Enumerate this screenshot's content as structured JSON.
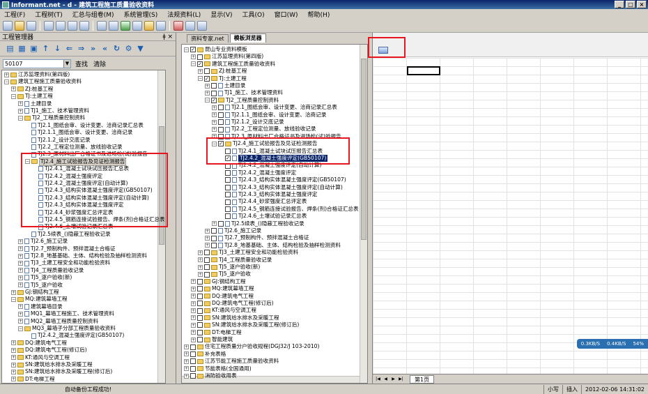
{
  "window": {
    "title": "Informant.net - d - 建筑工程施工质量验收资料"
  },
  "menu": [
    "工程(F)",
    "工程树(T)",
    "汇总与组卷(M)",
    "系统管理(S)",
    "法规资料(L)",
    "显示(V)",
    "工具(O)",
    "窗口(W)",
    "帮助(H)"
  ],
  "left": {
    "header": "工程管理器",
    "search": {
      "value": "50107",
      "find_label": "查找",
      "clear_label": "清除"
    },
    "tree": [
      {
        "d": 0,
        "t": "江苏监理资料(第四版)"
      },
      {
        "d": 0,
        "t": "建筑工程施工质量验收资料"
      },
      {
        "d": 1,
        "t": "ZJ:桩基工程"
      },
      {
        "d": 1,
        "t": "TJ:土建工程"
      },
      {
        "d": 2,
        "t": "土建目录"
      },
      {
        "d": 2,
        "t": "TJ1_施工、技术管理资料"
      },
      {
        "d": 2,
        "t": "TJ2_工程质量控制资料"
      },
      {
        "d": 3,
        "t": "TJ2.1_图纸会审、设计变更、洽商记录汇总表"
      },
      {
        "d": 3,
        "t": "TJ2.1.1_图纸会审、设计变更、洽商记录"
      },
      {
        "d": 3,
        "t": "TJ2.1.2_设计交底记录"
      },
      {
        "d": 3,
        "t": "TJ2.2_工程定位测量、放线验收记录"
      },
      {
        "d": 3,
        "t": "TJ2.3_原材料出厂合格证书及进场检(试)验报告"
      },
      {
        "d": 3,
        "t": "TJ2.4_施工试验报告及见证检测报告"
      },
      {
        "d": 4,
        "t": "TJ2.4.1_混凝土试块试压报告汇总表"
      },
      {
        "d": 4,
        "t": "TJ2.4.2_混凝土强度评定"
      },
      {
        "d": 4,
        "t": "TJ2.4.2_混凝土强度评定(自动计算)"
      },
      {
        "d": 4,
        "t": "TJ2.4.3_结构实体混凝土强度评定(GB50107)"
      },
      {
        "d": 4,
        "t": "TJ2.4.3_结构实体混凝土强度评定(自动计算)"
      },
      {
        "d": 4,
        "t": "TJ2.4.3_结构实体混凝土强度评定"
      },
      {
        "d": 4,
        "t": "TJ2.4.4_砂浆强度汇总评定表"
      },
      {
        "d": 4,
        "t": "TJ2.4.5_钢筋连接试验报告、焊条(剂)合格证汇总表"
      },
      {
        "d": 4,
        "t": "TJ2.4.6_土壤试验记录汇总表"
      },
      {
        "d": 3,
        "t": "TJ2.5续表_()隐蔽工程验收记录"
      },
      {
        "d": 2,
        "t": "TJ2.6_施工记录"
      },
      {
        "d": 2,
        "t": "TJ2.7_预制构件、预拌混凝土合格证"
      },
      {
        "d": 2,
        "t": "TJ2.8_地基基础、主体、结构检验及抽样检测资料"
      },
      {
        "d": 2,
        "t": "TJ3_土建工程安全和功能检验资料"
      },
      {
        "d": 2,
        "t": "TJ4_工程质量验收记录"
      },
      {
        "d": 2,
        "t": "TJ5_逐户验收(新)"
      },
      {
        "d": 2,
        "t": "TJ5_逐户验收"
      },
      {
        "d": 1,
        "t": "GJ:钢结构工程"
      },
      {
        "d": 1,
        "t": "MQ:建筑幕墙工程"
      },
      {
        "d": 2,
        "t": "建筑幕墙目录"
      },
      {
        "d": 2,
        "t": "MQ1_幕墙工程施工、技术管理资料"
      },
      {
        "d": 2,
        "t": "MQ2_幕墙工程质量控制资料"
      },
      {
        "d": 2,
        "t": "MQ3_幕墙子分部工程质量验收资料"
      },
      {
        "d": 3,
        "t": "TJ2.4.2_混凝土强度评定(GB50107)"
      },
      {
        "d": 1,
        "t": "DQ:建筑电气工程"
      },
      {
        "d": 1,
        "t": "DQ:建筑电气工程(修订后)"
      },
      {
        "d": 1,
        "t": "KT:通风与空调工程"
      },
      {
        "d": 1,
        "t": "SN:建筑给水排水及采暖工程"
      },
      {
        "d": 1,
        "t": "SN:建筑给水排水及采暖工程(修订后)"
      },
      {
        "d": 1,
        "t": "DT:电梯工程"
      }
    ]
  },
  "middle": {
    "tabs": [
      "资料专家.net",
      "模板浏览器"
    ],
    "tree": [
      {
        "d": 0,
        "t": "昆山专业资料模板"
      },
      {
        "d": 1,
        "t": "江苏监理资料(第四版)"
      },
      {
        "d": 1,
        "t": "建筑工程施工质量验收资料"
      },
      {
        "d": 2,
        "t": "ZJ:桩基工程"
      },
      {
        "d": 2,
        "t": "TJ:土建工程"
      },
      {
        "d": 3,
        "t": "土建目录"
      },
      {
        "d": 3,
        "t": "TJ1_施工、技术管理资料"
      },
      {
        "d": 3,
        "t": "TJ2_工程质量控制资料"
      },
      {
        "d": 4,
        "t": "TJ2.1_图纸会审、设计变更、洽商记录汇总表"
      },
      {
        "d": 4,
        "t": "TJ2.1.1_图纸会审、设计变更、洽商记录"
      },
      {
        "d": 4,
        "t": "TJ2.1.2_设计交底记录"
      },
      {
        "d": 4,
        "t": "TJ2.2_工程定位测量、放线验收记录"
      },
      {
        "d": 4,
        "t": "TJ2.3_原材料出厂合格证书及进场检(试)验报告"
      },
      {
        "d": 4,
        "t": "TJ2.4_施工试验报告及见证检测报告"
      },
      {
        "d": 5,
        "t": "TJ2.4.1_混凝土试块试压报告汇总表"
      },
      {
        "d": 5,
        "t": "TJ2.4.2_混凝土强度评定(GB50107)"
      },
      {
        "d": 5,
        "t": "TJ2.4.2_混凝土强度评定(自动计算)"
      },
      {
        "d": 5,
        "t": "TJ2.4.2_混凝土强度评定"
      },
      {
        "d": 5,
        "t": "TJ2.4.3_结构实体混凝土强度评定(GB50107)"
      },
      {
        "d": 5,
        "t": "TJ2.4.3_结构实体混凝土强度评定(自动计算)"
      },
      {
        "d": 5,
        "t": "TJ2.4.3_结构实体混凝土强度评定"
      },
      {
        "d": 5,
        "t": "TJ2.4.4_砂浆强度汇总评定表"
      },
      {
        "d": 5,
        "t": "TJ2.4.5_钢筋连接试验报告、焊条(剂)合格证汇总表"
      },
      {
        "d": 5,
        "t": "TJ2.4.6_土壤试验记录汇总表"
      },
      {
        "d": 4,
        "t": "TJ2.5续表_()隐蔽工程验收记录"
      },
      {
        "d": 3,
        "t": "TJ2.6_施工记录"
      },
      {
        "d": 3,
        "t": "TJ2.7_预制构件、预拌混凝土合格证"
      },
      {
        "d": 3,
        "t": "TJ2.8_地基基础、主体、结构检验及抽样检测资料"
      },
      {
        "d": 2,
        "t": "TJ3_土建工程安全和功能检验资料"
      },
      {
        "d": 2,
        "t": "TJ4_工程质量验收记录"
      },
      {
        "d": 2,
        "t": "TJ5_逐户验收(新)"
      },
      {
        "d": 2,
        "t": "TJ5_逐户验收"
      },
      {
        "d": 1,
        "t": "GJ:钢结构工程"
      },
      {
        "d": 1,
        "t": "MQ:建筑幕墙工程"
      },
      {
        "d": 1,
        "t": "DQ:建筑电气工程"
      },
      {
        "d": 1,
        "t": "DQ:建筑电气工程(修订后)"
      },
      {
        "d": 1,
        "t": "KT:通风与空调工程"
      },
      {
        "d": 1,
        "t": "SN:建筑给水排水及采暖工程"
      },
      {
        "d": 1,
        "t": "SN:建筑给水排水及采暖工程(修订后)"
      },
      {
        "d": 1,
        "t": "DT:电梯工程"
      },
      {
        "d": 1,
        "t": "智能建筑"
      },
      {
        "d": 0,
        "t": "住宅工程质量分户验收规程(DGJ32/J 103-2010)"
      },
      {
        "d": 0,
        "t": "补充表格"
      },
      {
        "d": 0,
        "t": "江苏节能工程施工质量验收资料"
      },
      {
        "d": 0,
        "t": "节能表格(全国通用)"
      },
      {
        "d": 0,
        "t": "消防验收用表"
      }
    ]
  },
  "right": {
    "sheet_tab": "第1页",
    "netspeed": [
      "0.3KB/S",
      "0.4KB/S",
      "54%"
    ]
  },
  "status": {
    "message": "自动备份工程成功!",
    "caps": "小写",
    "insert": "插入",
    "datetime": "2012-02-06 14:31:02"
  }
}
